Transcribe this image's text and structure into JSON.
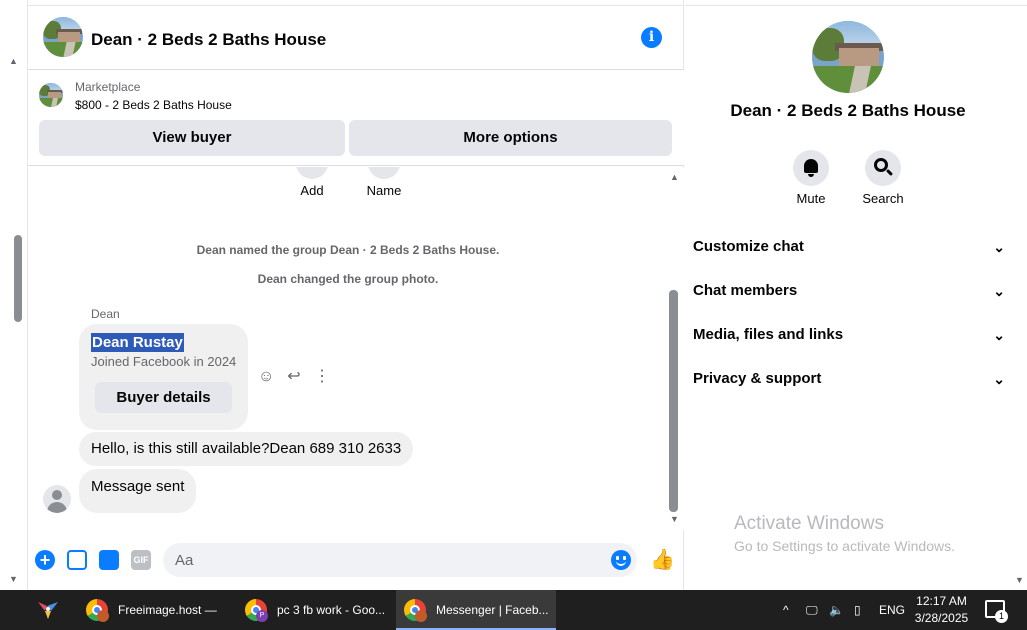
{
  "chat": {
    "title": "Dean · 2 Beds 2 Baths House",
    "marketplace": {
      "label": "Marketplace",
      "listing": "$800 - 2 Beds 2 Baths House",
      "view_buyer": "View buyer",
      "more_options": "More options"
    },
    "quick_actions": [
      "Add",
      "Name"
    ],
    "system_messages": [
      "Dean named the group Dean · 2 Beds 2 Baths House.",
      "Dean changed the group photo."
    ],
    "sender": "Dean",
    "buyer_card": {
      "name": "Dean Rustay",
      "joined": "Joined Facebook in 2024",
      "button": "Buyer details"
    },
    "messages": [
      "Hello, is this still available?Dean 689 310 2633",
      "Message sent"
    ],
    "composer": {
      "placeholder": "Aa",
      "gif": "GIF"
    }
  },
  "panel": {
    "title": "Dean · 2 Beds 2 Baths House",
    "actions": [
      "Mute",
      "Search"
    ],
    "sections": [
      "Customize chat",
      "Chat members",
      "Media, files and links",
      "Privacy & support"
    ],
    "watermark_title": "Activate Windows",
    "watermark_sub": "Go to Settings to activate Windows."
  },
  "taskbar": {
    "apps": [
      "Freeimage.host — I...",
      "pc 3 fb work - Goo...",
      "Messenger | Faceb..."
    ],
    "badges": [
      "",
      "P",
      ""
    ],
    "language": "ENG",
    "time": "12:17 AM",
    "date": "3/28/2025",
    "notifications": "1"
  },
  "colors": {
    "accent": "#0a7cff",
    "bubble": "#f0f0f0",
    "button": "#e4e6eb",
    "taskbar": "#1f1f1f"
  }
}
